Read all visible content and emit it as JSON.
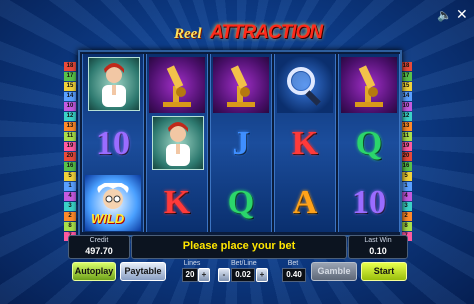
{
  "logo": {
    "part1": "Reel",
    "part2": "ATTRACTION"
  },
  "top_icons": {
    "sound": "speaker-icon",
    "close": "close-icon"
  },
  "reels": [
    [
      "doctor-woman",
      "10",
      "wild"
    ],
    [
      "microscope",
      "doctor-woman",
      "K"
    ],
    [
      "microscope",
      "J",
      "Q"
    ],
    [
      "magnifier",
      "K",
      "A"
    ],
    [
      "microscope",
      "Q",
      "10"
    ]
  ],
  "wild_label": "WILD",
  "paylines_left": [
    "18",
    "17",
    "15",
    "14",
    "10",
    "12",
    "13",
    "11",
    "19",
    "20",
    "16",
    "5",
    "1",
    "4",
    "3",
    "2",
    "8",
    "7"
  ],
  "paylines_right": [
    "18",
    "17",
    "15",
    "14",
    "10",
    "12",
    "13",
    "11",
    "19",
    "20",
    "16",
    "5",
    "1",
    "4",
    "3",
    "2",
    "8",
    "7"
  ],
  "letter_colors": {
    "10": "#9b6cff",
    "J": "#3f8fff",
    "Q": "#2bd66b",
    "K": "#ff3a3a",
    "A": "#ffa21a"
  },
  "credit": {
    "label": "Credit",
    "value": "497.70"
  },
  "message": "Please place your bet",
  "last_win": {
    "label": "Last Win",
    "value": "0.10"
  },
  "buttons": {
    "autoplay": "Autoplay",
    "paytable": "Paytable",
    "gamble": "Gamble",
    "start": "Start"
  },
  "lines": {
    "label": "Lines",
    "value": "20"
  },
  "bet_line": {
    "label": "Bet/Line",
    "value": "0.02"
  },
  "bet": {
    "label": "Bet",
    "value": "0.40"
  }
}
